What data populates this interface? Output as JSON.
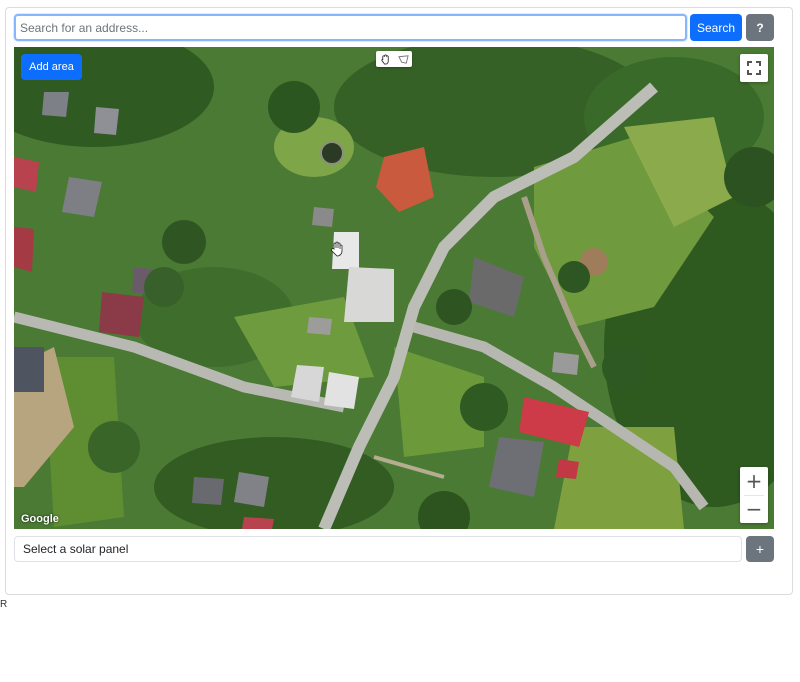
{
  "search": {
    "placeholder": "Search for an address...",
    "value": "",
    "search_button": "Search",
    "help_button": "?"
  },
  "map": {
    "add_area_button": "Add area",
    "attribution": "Google",
    "zoom_in": "+",
    "zoom_out": "−",
    "map_type": "satellite",
    "draw_tools": [
      "hand-icon",
      "polygon-icon"
    ]
  },
  "panel": {
    "select_placeholder": "Select a solar panel",
    "add_button": "+"
  },
  "footer_text": "R",
  "colors": {
    "primary": "#0d6efd",
    "secondary": "#6c757d"
  }
}
